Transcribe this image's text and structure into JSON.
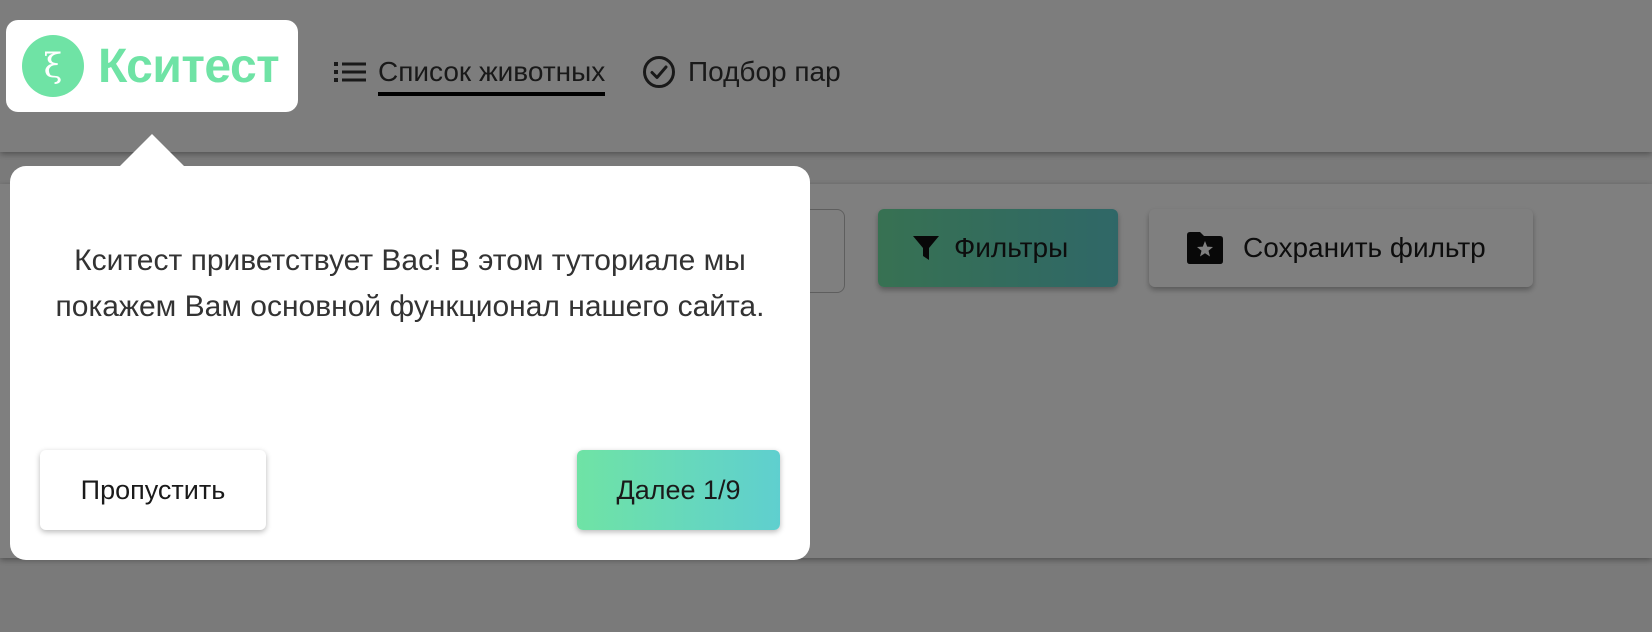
{
  "app": {
    "logo_text": "Кситест",
    "logo_symbol": "ξ",
    "brand_color": "#6fe3a5",
    "accent_gradient_end": "#5fcfcf"
  },
  "nav": {
    "items": [
      {
        "label": "Список животных",
        "icon": "list-icon",
        "active": true
      },
      {
        "label": "Подбор пар",
        "icon": "check-circle-icon",
        "active": false
      }
    ]
  },
  "toolbar": {
    "filter_label": "Фильтры",
    "filter_icon": "filter-icon",
    "save_filter_label": "Сохранить фильтр",
    "save_filter_icon": "folder-star-icon"
  },
  "tutorial": {
    "message": "Кситест приветствует Вас! В этом туториале мы покажем Вам основной функционал нашего сайта.",
    "skip_label": "Пропустить",
    "next_label": "Далее 1/9"
  }
}
